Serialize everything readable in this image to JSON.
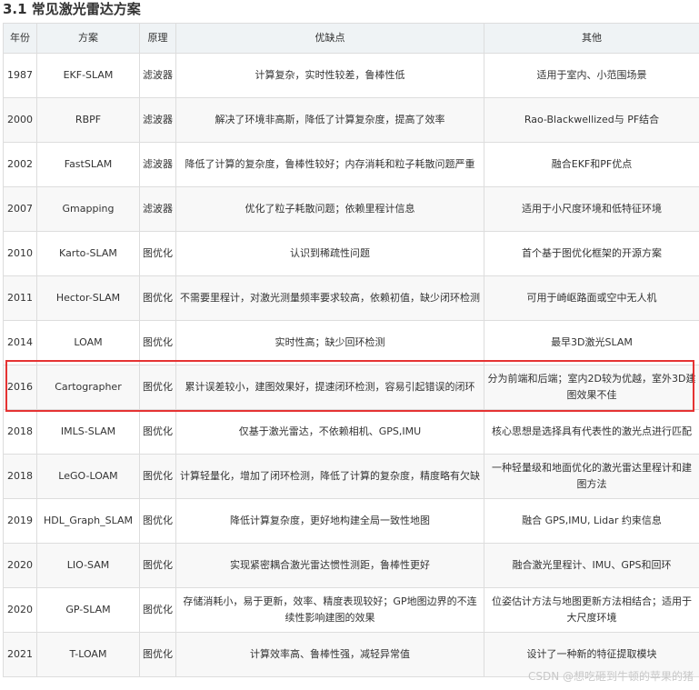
{
  "heading": "3.1 常见激光雷达方案",
  "table": {
    "headers": [
      "年份",
      "方案",
      "原理",
      "优缺点",
      "其他"
    ],
    "rows": [
      [
        "1987",
        "EKF-SLAM",
        "滤波器",
        "计算复杂，实时性较差，鲁棒性低",
        "适用于室内、小范围场景"
      ],
      [
        "2000",
        "RBPF",
        "滤波器",
        "解决了环境非高斯，降低了计算复杂度，提高了效率",
        "Rao-Blackwellized与 PF结合"
      ],
      [
        "2002",
        "FastSLAM",
        "滤波器",
        "降低了计算的复杂度，鲁棒性较好；内存消耗和粒子耗散问题严重",
        "融合EKF和PF优点"
      ],
      [
        "2007",
        "Gmapping",
        "滤波器",
        "优化了粒子耗散问题；依赖里程计信息",
        "适用于小尺度环境和低特征环境"
      ],
      [
        "2010",
        "Karto-SLAM",
        "图优化",
        "认识到稀疏性问题",
        "首个基于图优化框架的开源方案"
      ],
      [
        "2011",
        "Hector-SLAM",
        "图优化",
        "不需要里程计，对激光测量频率要求较高，依赖初值，缺少闭环检测",
        "可用于崎岖路面或空中无人机"
      ],
      [
        "2014",
        "LOAM",
        "图优化",
        "实时性高；缺少回环检测",
        "最早3D激光SLAM"
      ],
      [
        "2016",
        "Cartographer",
        "图优化",
        "累计误差较小，建图效果好，提速闭环检测，容易引起错误的闭环",
        "分为前端和后端；室内2D较为优越，室外3D建图效果不佳"
      ],
      [
        "2018",
        "IMLS-SLAM",
        "图优化",
        "仅基于激光雷达，不依赖相机、GPS,IMU",
        "核心思想是选择具有代表性的激光点进行匹配"
      ],
      [
        "2018",
        "LeGO-LOAM",
        "图优化",
        "计算轻量化，增加了闭环检测，降低了计算的复杂度，精度略有欠缺",
        "一种轻量级和地面优化的激光雷达里程计和建图方法"
      ],
      [
        "2019",
        "HDL_Graph_SLAM",
        "图优化",
        "降低计算复杂度，更好地构建全局一致性地图",
        "融合 GPS,IMU, Lidar 约束信息"
      ],
      [
        "2020",
        "LIO-SAM",
        "图优化",
        "实现紧密耦合激光雷达惯性测距，鲁棒性更好",
        "融合激光里程计、IMU、GPS和回环"
      ],
      [
        "2020",
        "GP-SLAM",
        "图优化",
        "存储消耗小，易于更新，效率、精度表现较好；GP地图边界的不连续性影响建图的效果",
        "位姿估计方法与地图更新方法相结合；适用于大尺度环境"
      ],
      [
        "2021",
        "T-LOAM",
        "图优化",
        "计算效率高、鲁棒性强，减轻异常值",
        "设计了一种新的特征提取模块"
      ]
    ]
  },
  "highlight_color": "#e53333",
  "watermark": "CSDN @想吃砸到牛顿的苹果的猪"
}
